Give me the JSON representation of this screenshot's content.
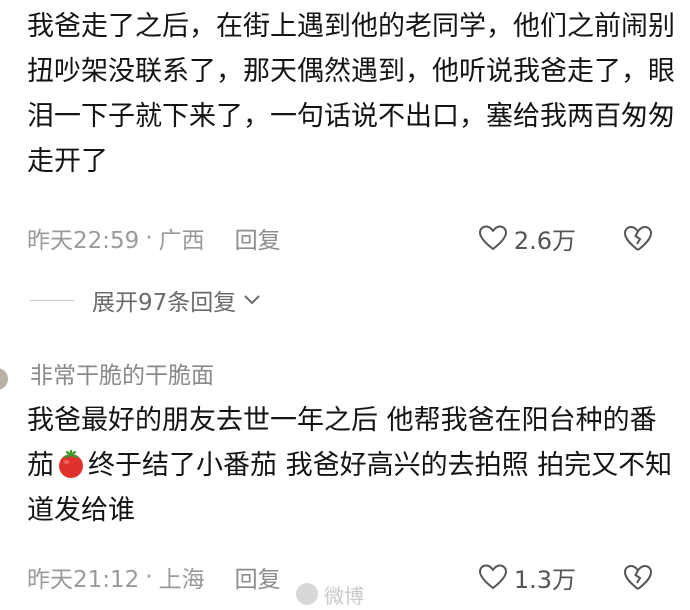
{
  "comment1": {
    "text": "我爸走了之后，在街上遇到他的老同学，他们之前闹别扭吵架没联系了，那天偶然遇到，他听说我爸走了，眼泪一下子就下来了，一句话说不出口，塞给我两百匆匆走开了",
    "time": "昨天22:59",
    "separator": "·",
    "location": "广西",
    "reply_label": "回复",
    "like_count": "2.6万",
    "expand_label": "展开97条回复"
  },
  "comment2": {
    "username": "非常干脆的干脆面",
    "text_before": "我爸最好的朋友去世一年之后 他帮我爸在阳台种的番茄",
    "emoji": "tomato-emoji",
    "text_after": "终于结了小番茄 我爸好高兴的去拍照 拍完又不知道发给谁",
    "time": "昨天21:12",
    "separator": "·",
    "location": "上海",
    "reply_label": "回复",
    "like_count": "1.3万"
  },
  "watermark": {
    "text": "微博"
  },
  "colors": {
    "text": "#141414",
    "meta": "#9a9a9a",
    "icon": "#555555"
  }
}
